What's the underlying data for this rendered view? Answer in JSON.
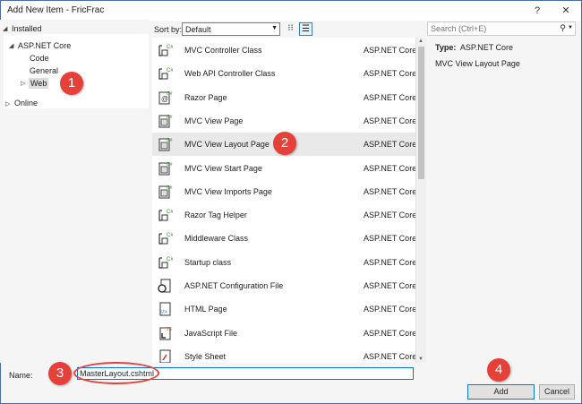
{
  "window": {
    "title": "Add New Item - FricFrac",
    "help_label": "?",
    "close_label": "✕"
  },
  "tree": {
    "installed": "Installed",
    "aspnet_core": "ASP.NET Core",
    "code": "Code",
    "general": "General",
    "web": "Web",
    "online": "Online"
  },
  "toolbar": {
    "sort_label": "Sort by:",
    "sort_value": "Default"
  },
  "templates": [
    {
      "name": "MVC Controller Class",
      "lang": "ASP.NET Core",
      "icon": "csharp-class-icon"
    },
    {
      "name": "Web API Controller Class",
      "lang": "ASP.NET Core",
      "icon": "csharp-class-icon"
    },
    {
      "name": "Razor Page",
      "lang": "ASP.NET Core",
      "icon": "razor-page-icon"
    },
    {
      "name": "MVC View Page",
      "lang": "ASP.NET Core",
      "icon": "razor-view-icon"
    },
    {
      "name": "MVC View Layout Page",
      "lang": "ASP.NET Core",
      "icon": "razor-view-icon"
    },
    {
      "name": "MVC View Start Page",
      "lang": "ASP.NET Core",
      "icon": "razor-view-icon"
    },
    {
      "name": "MVC View Imports Page",
      "lang": "ASP.NET Core",
      "icon": "razor-view-icon"
    },
    {
      "name": "Razor Tag Helper",
      "lang": "ASP.NET Core",
      "icon": "csharp-class-icon"
    },
    {
      "name": "Middleware Class",
      "lang": "ASP.NET Core",
      "icon": "csharp-class-icon"
    },
    {
      "name": "Startup class",
      "lang": "ASP.NET Core",
      "icon": "csharp-class-icon"
    },
    {
      "name": "ASP.NET Configuration File",
      "lang": "ASP.NET Core",
      "icon": "config-file-icon"
    },
    {
      "name": "HTML Page",
      "lang": "ASP.NET Core",
      "icon": "html-page-icon"
    },
    {
      "name": "JavaScript File",
      "lang": "ASP.NET Core",
      "icon": "javascript-file-icon"
    },
    {
      "name": "Style Sheet",
      "lang": "ASP.NET Core",
      "icon": "stylesheet-icon"
    }
  ],
  "selected_index": 4,
  "search": {
    "placeholder": "Search (Ctrl+E)"
  },
  "details": {
    "type_label": "Type:",
    "type_value": "ASP.NET Core",
    "description": "MVC View Layout Page"
  },
  "name": {
    "label": "Name:",
    "value": "MasterLayout.cshtml"
  },
  "buttons": {
    "add": "Add",
    "cancel": "Cancel"
  },
  "annotations": [
    "1",
    "2",
    "3",
    "4"
  ],
  "colors": {
    "annotation": "#e5413a",
    "accent": "#0078d7"
  }
}
